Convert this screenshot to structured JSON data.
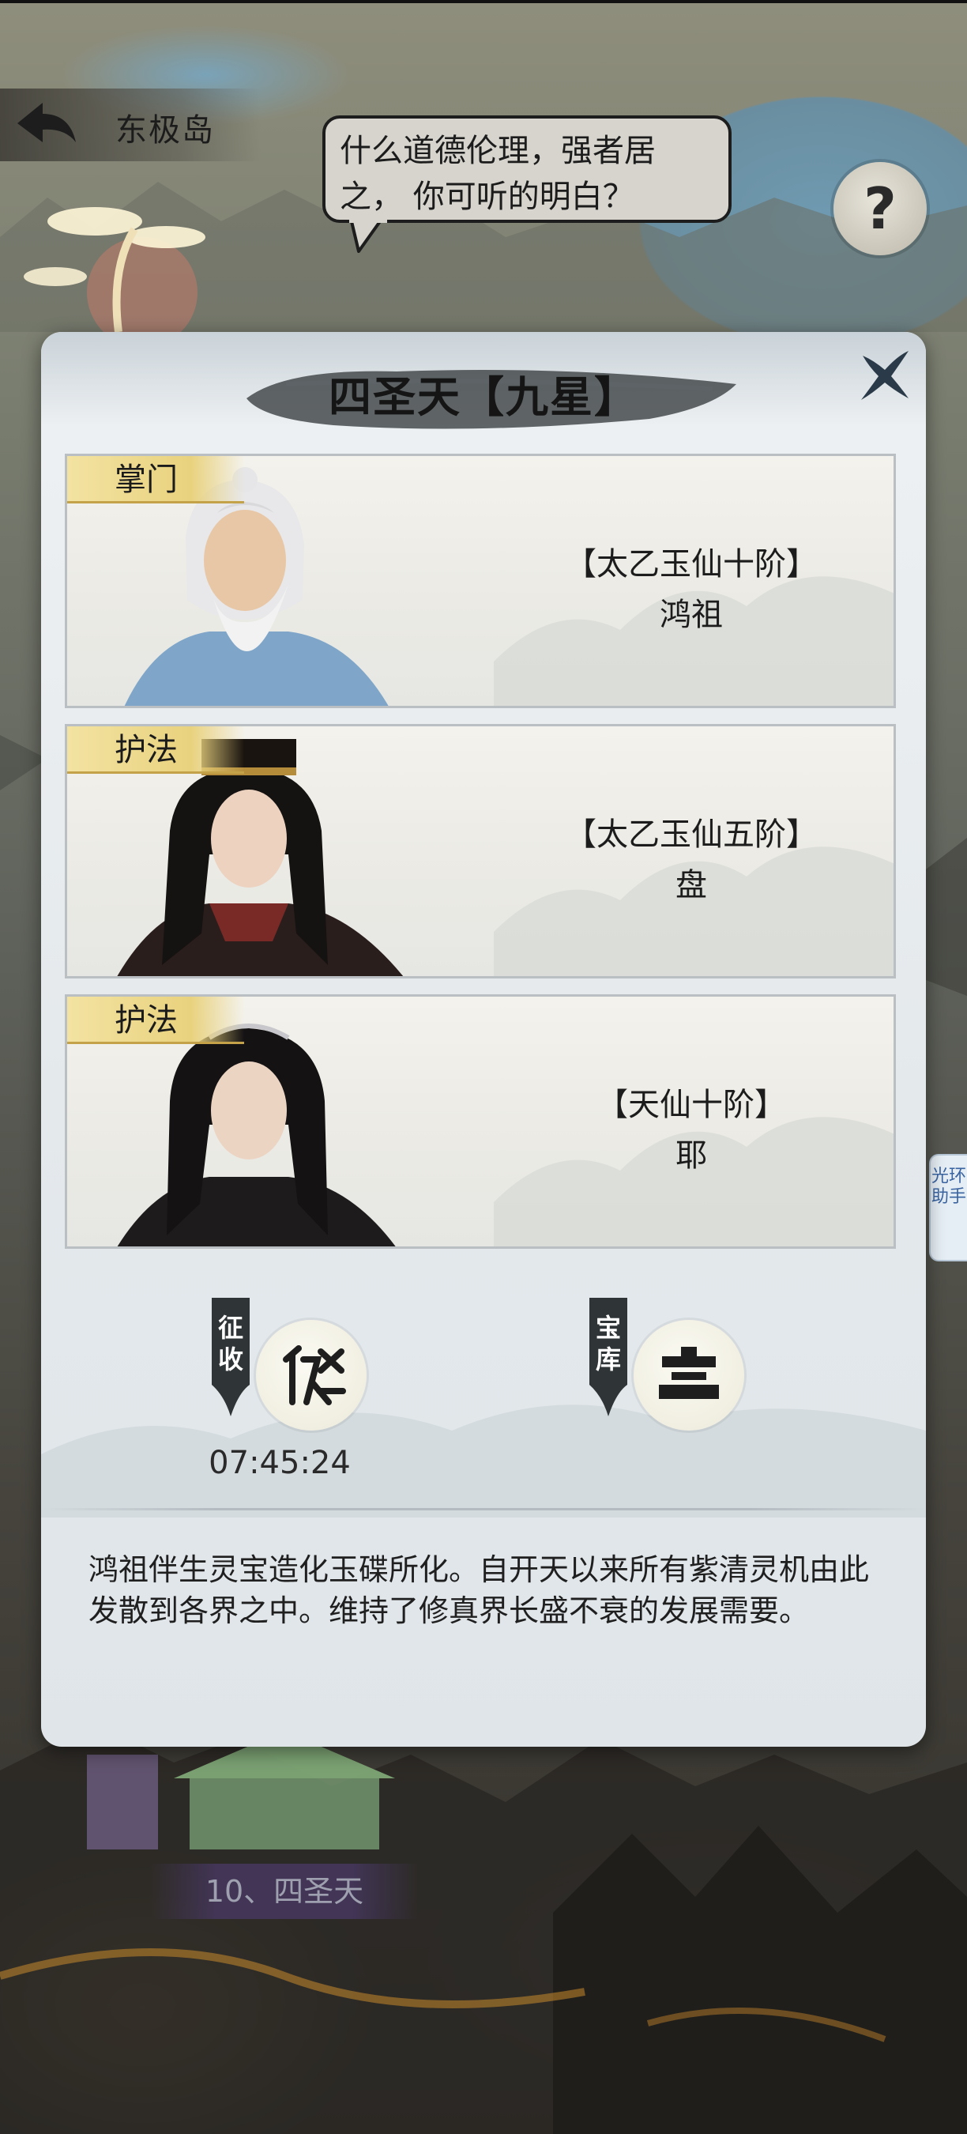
{
  "header": {
    "location_title": "东极岛",
    "speech": [
      "什么道德伦理，强者居",
      "之， 你可听的明白？"
    ],
    "help_symbol": "?"
  },
  "side_helper": {
    "label": "光环助手"
  },
  "map": {
    "sect_label": "10、四圣天"
  },
  "dialog": {
    "title": "四圣天【九星】",
    "members": [
      {
        "role": "掌门",
        "rank": "【太乙玉仙十阶】",
        "name": "鸿祖"
      },
      {
        "role": "护法",
        "rank": "【太乙玉仙五阶】",
        "name": "盘"
      },
      {
        "role": "护法",
        "rank": "【天仙十阶】",
        "name": "耶"
      }
    ],
    "actions": {
      "levy": {
        "label": "征收",
        "timer": "07:45:24",
        "icon": "levy-icon"
      },
      "treasury": {
        "label": "宝库",
        "icon": "treasury-icon"
      }
    },
    "description": "鸿祖伴生灵宝造化玉碟所化。自开天以来所有紫清灵机由此发散到各界之中。维持了修真界长盛不衰的发展需要。"
  },
  "colors": {
    "role_tag": "#e9d27e",
    "dialog_bg": "#e4e9ec",
    "side_helper_text": "#3a64a0"
  }
}
